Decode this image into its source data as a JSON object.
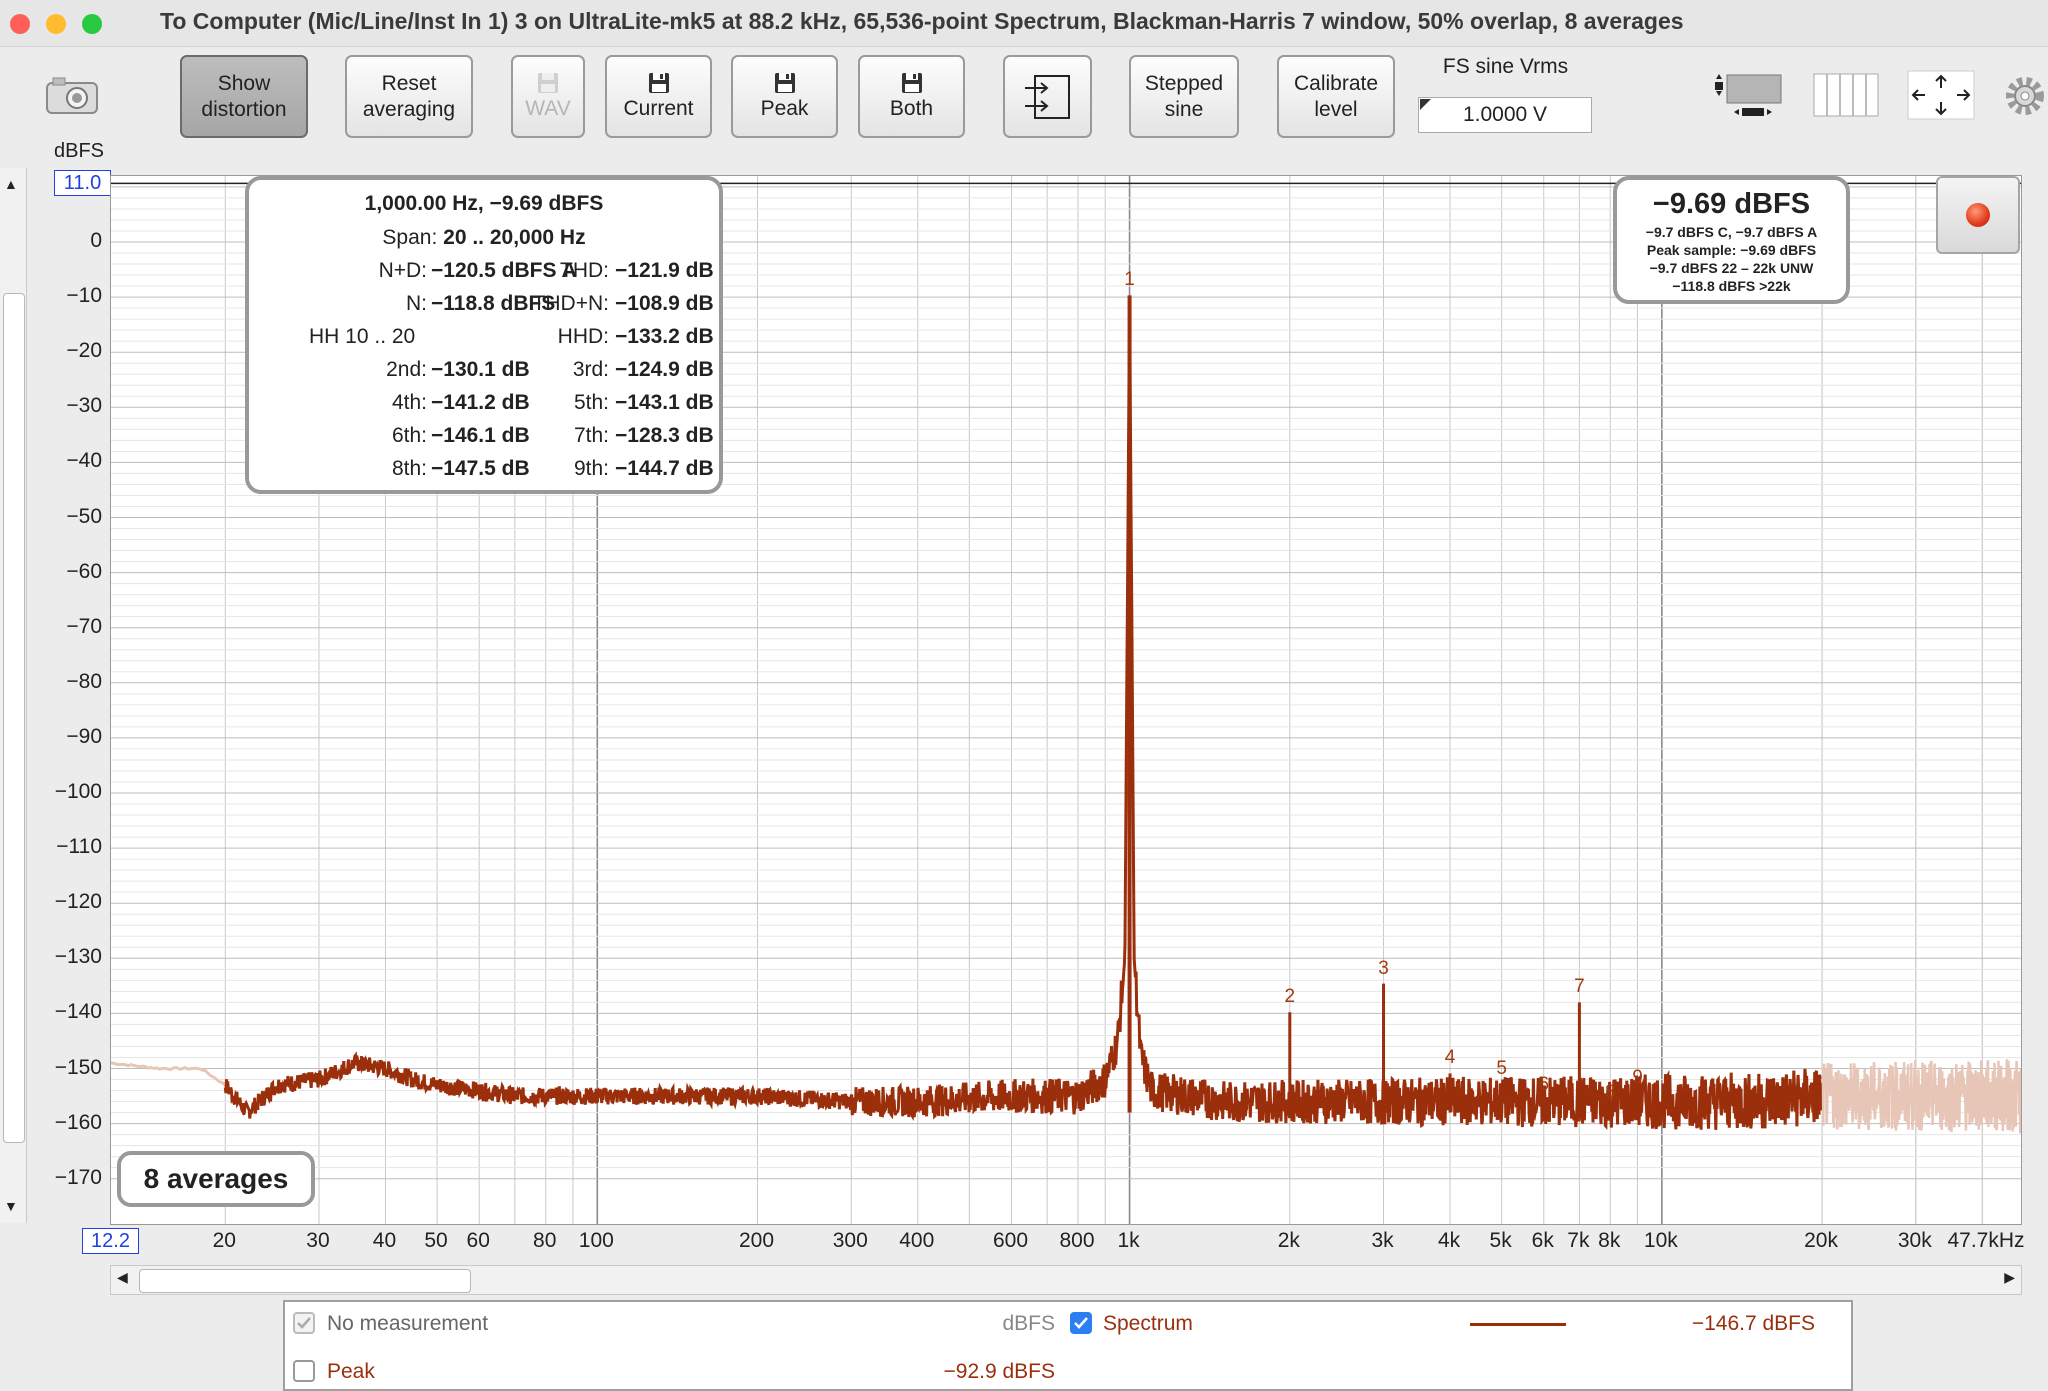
{
  "window": {
    "title": "To Computer (Mic/Line/Inst In 1) 3 on UltraLite-mk5 at 88.2 kHz, 65,536-point Spectrum, Blackman-Harris 7 window, 50% overlap, 8 averages"
  },
  "toolbar": {
    "show_distortion": [
      "Show",
      "distortion"
    ],
    "reset_averaging": [
      "Reset",
      "averaging"
    ],
    "wav": "WAV",
    "current": "Current",
    "peak": "Peak",
    "both": "Both",
    "stepped_sine": [
      "Stepped",
      "sine"
    ],
    "calibrate_level": [
      "Calibrate",
      "level"
    ],
    "fs_label": "FS sine Vrms",
    "fs_value": "1.0000 V"
  },
  "axis": {
    "y_unit": "dBFS",
    "y_top_field": "11.0",
    "x_left_field": "12.2",
    "y_ticks": [
      "0",
      "−10",
      "−20",
      "−30",
      "−40",
      "−50",
      "−60",
      "−70",
      "−80",
      "−90",
      "−100",
      "−110",
      "−120",
      "−130",
      "−140",
      "−150",
      "−160",
      "−170"
    ],
    "x_ticks": [
      "20",
      "30",
      "40",
      "50",
      "60",
      "80",
      "100",
      "200",
      "300",
      "400",
      "600",
      "800",
      "1k",
      "2k",
      "3k",
      "4k",
      "5k",
      "6k",
      "7k",
      "8k",
      "10k",
      "20k",
      "30k",
      "47.7kHz"
    ]
  },
  "measurements": {
    "header": "1,000.00 Hz, −9.69 dBFS",
    "span_label": "Span:",
    "span_value": "20 .. 20,000 Hz",
    "nd_label": "N+D:",
    "nd_value": "−120.5 dBFS A",
    "thd_label": "THD:",
    "thd_value": "−121.9 dB",
    "n_label": "N:",
    "n_value": "−118.8 dBFS",
    "thdn_label": "THD+N:",
    "thdn_value": "−108.9 dB",
    "hh_label": "HH 10 .. 20",
    "hhd_label": "HHD:",
    "hhd_value": "−133.2 dB",
    "h2_label": "2nd:",
    "h2": "−130.1 dB",
    "h3_label": "3rd:",
    "h3": "−124.9 dB",
    "h4_label": "4th:",
    "h4": "−141.2 dB",
    "h5_label": "5th:",
    "h5": "−143.1 dB",
    "h6_label": "6th:",
    "h6": "−146.1 dB",
    "h7_label": "7th:",
    "h7": "−128.3 dB",
    "h8_label": "8th:",
    "h8": "−147.5 dB",
    "h9_label": "9th:",
    "h9": "−144.7 dB"
  },
  "level_box": {
    "main": "−9.69 dBFS",
    "line1": "−9.7 dBFS C, −9.7 dBFS A",
    "line2": "Peak sample: −9.69 dBFS",
    "line3": "−9.7 dBFS 22 – 22k UNW",
    "line4": "−118.8 dBFS >22k"
  },
  "averages_badge": "8 averages",
  "harmonic_labels": [
    "1",
    "2",
    "3",
    "4",
    "5",
    "6",
    "7",
    "8",
    "9"
  ],
  "legend": {
    "no_measurement": "No measurement",
    "no_measurement_unit": "dBFS",
    "spectrum": "Spectrum",
    "spectrum_value": "−146.7 dBFS",
    "peak": "Peak",
    "peak_value": "−92.9 dBFS"
  },
  "chart_data": {
    "type": "line",
    "x_scale": "log",
    "xlim": [
      12.2,
      47700
    ],
    "ylim": [
      -180,
      11.0
    ],
    "ylabel": "dBFS",
    "grid": true,
    "series": [
      {
        "name": "Spectrum",
        "color": "#9b2f0c",
        "x": [
          12.2,
          15,
          18,
          20,
          22,
          25,
          30,
          35,
          40,
          45,
          50,
          60,
          70,
          80,
          100,
          150,
          200,
          300,
          400,
          600,
          800,
          900,
          950,
          980,
          1000,
          1020,
          1050,
          1100,
          1500,
          2000,
          3000,
          4000,
          5000,
          6000,
          7000,
          8000,
          9000,
          10000,
          15000,
          20000
        ],
        "y": [
          -149,
          -150,
          -150,
          -153,
          -158,
          -153,
          -152,
          -149,
          -150,
          -152,
          -153,
          -154,
          -155,
          -155,
          -155,
          -155,
          -155,
          -156,
          -156,
          -155,
          -155,
          -152,
          -145,
          -130,
          -9.69,
          -130,
          -148,
          -154,
          -156,
          -156,
          -156,
          -156,
          -156,
          -156,
          -156,
          -156,
          -156,
          -156,
          -156,
          -155
        ]
      }
    ],
    "harmonics": [
      {
        "n": 1,
        "f": 1000,
        "dBFS": -9.69
      },
      {
        "n": 2,
        "f": 2000,
        "dBFS": -139.8
      },
      {
        "n": 3,
        "f": 3000,
        "dBFS": -134.6
      },
      {
        "n": 4,
        "f": 4000,
        "dBFS": -150.9
      },
      {
        "n": 5,
        "f": 5000,
        "dBFS": -152.8
      },
      {
        "n": 6,
        "f": 6000,
        "dBFS": -155.8
      },
      {
        "n": 7,
        "f": 7000,
        "dBFS": -138.0
      },
      {
        "n": 8,
        "f": 8000,
        "dBFS": -157.2
      },
      {
        "n": 9,
        "f": 9000,
        "dBFS": -154.4
      }
    ]
  },
  "colors": {
    "trace": "#9b2f0c",
    "trace_out_of_span": "#e7c6b8",
    "record_button": "#e03a1a"
  }
}
